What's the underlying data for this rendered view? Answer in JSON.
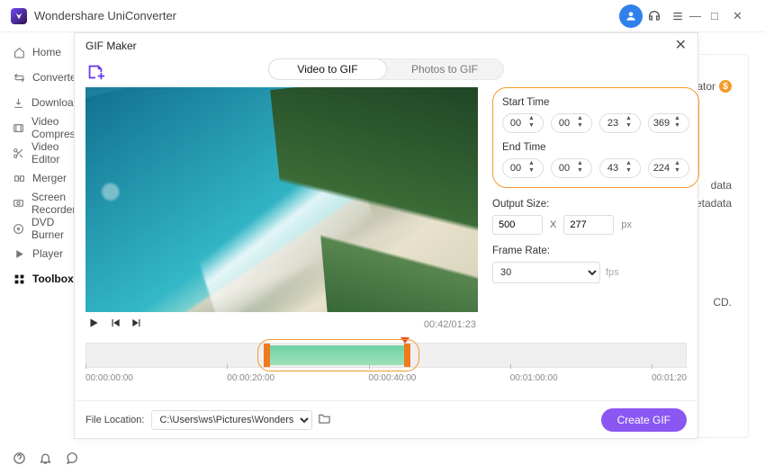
{
  "app": {
    "title": "Wondershare UniConverter"
  },
  "window_controls": {
    "min": "—",
    "max": "□",
    "close": "✕"
  },
  "sidebar": {
    "items": [
      {
        "label": "Home"
      },
      {
        "label": "Converter"
      },
      {
        "label": "Downloader"
      },
      {
        "label": "Video Compressor"
      },
      {
        "label": "Video Editor"
      },
      {
        "label": "Merger"
      },
      {
        "label": "Screen Recorder"
      },
      {
        "label": "DVD Burner"
      },
      {
        "label": "Player"
      },
      {
        "label": "Toolbox"
      }
    ]
  },
  "bg": {
    "ator": "ator",
    "data": "data",
    "tetadata": "tetadata",
    "cd": "CD."
  },
  "modal": {
    "title": "GIF Maker",
    "tabs": {
      "video": "Video to GIF",
      "photos": "Photos to GIF"
    },
    "playtime": "00:42/01:23",
    "start_label": "Start Time",
    "end_label": "End Time",
    "start": {
      "hh": "00",
      "mm": "00",
      "ss": "23",
      "ms": "369"
    },
    "end": {
      "hh": "00",
      "mm": "00",
      "ss": "43",
      "ms": "224"
    },
    "outputsize_label": "Output Size:",
    "output": {
      "w": "500",
      "x": "X",
      "h": "277",
      "unit": "px"
    },
    "framerate_label": "Frame Rate:",
    "framerate": {
      "value": "30",
      "unit": "fps"
    },
    "timeline": {
      "ticks": [
        "00:00:00:00",
        "00:00:20:00",
        "00:00:40:00",
        "00:01:00:00",
        "00:01:20"
      ]
    },
    "filelocation_label": "File Location:",
    "filelocation": "C:\\Users\\ws\\Pictures\\Wonders",
    "create": "Create GIF"
  }
}
